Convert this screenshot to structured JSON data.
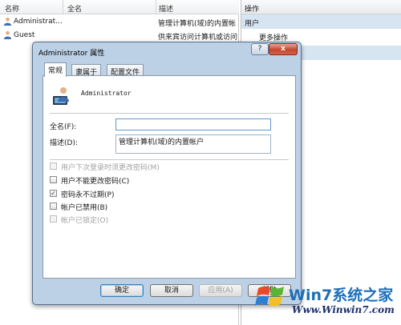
{
  "list": {
    "columns": [
      "名称",
      "全名",
      "描述"
    ],
    "rows": [
      {
        "name": "Administrat...",
        "fullname": "",
        "description": "管理计算机(域)的内置帐"
      },
      {
        "name": "Guest",
        "fullname": "",
        "description": "供来宾访问计算机或访问"
      }
    ]
  },
  "actions": {
    "title": "操作",
    "group": "用户",
    "more": "更多操作"
  },
  "dialog": {
    "title": "Administrator 属性",
    "help": "?",
    "close": "x",
    "tabs": [
      "常规",
      "隶属于",
      "配置文件"
    ],
    "user_name": "Administrator",
    "fullname_label": "全名(F):",
    "fullname_value": "",
    "description_label": "描述(D):",
    "description_value": "管理计算机(域)的内置帐户",
    "checkboxes": [
      {
        "label": "用户下次登录时须更改密码(M)",
        "checked": false,
        "enabled": false
      },
      {
        "label": "用户不能更改密码(C)",
        "checked": false,
        "enabled": true
      },
      {
        "label": "密码永不过期(P)",
        "checked": true,
        "enabled": true
      },
      {
        "label": "帐户已禁用(B)",
        "checked": false,
        "enabled": true
      },
      {
        "label": "帐户已锁定(O)",
        "checked": false,
        "enabled": false
      }
    ],
    "buttons": {
      "ok": "确定",
      "cancel": "取消",
      "apply": "应用(A)",
      "help": "帮助"
    }
  },
  "watermark": {
    "brand": "Win7系统之家",
    "url": "Www.Winwin7.com"
  },
  "colors": {
    "selected_group": "#d7e4f2",
    "dialog_frame": "#bcd0e6",
    "focus_border": "#5d9ad3"
  }
}
